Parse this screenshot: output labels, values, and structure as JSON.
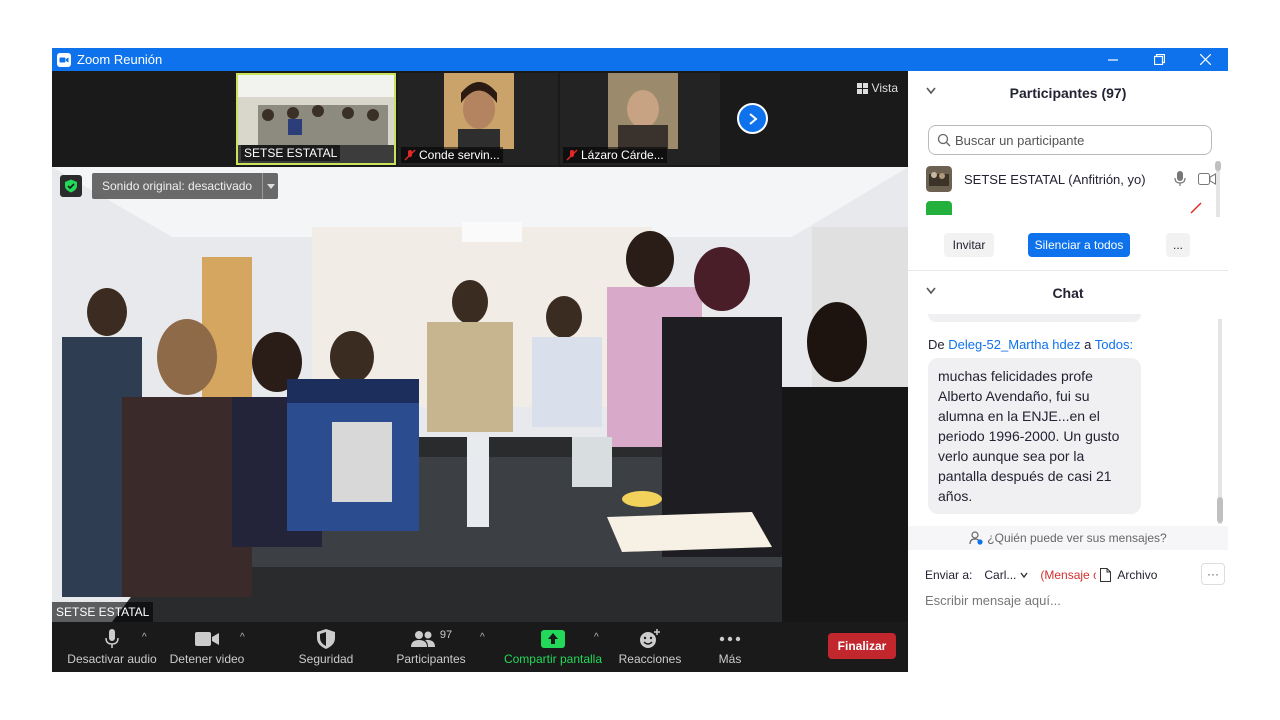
{
  "window": {
    "title": "Zoom Reunión"
  },
  "strip": {
    "thumbnails": [
      {
        "name": "SETSE ESTATAL",
        "muted": false
      },
      {
        "name": "Conde servin...",
        "muted": true
      },
      {
        "name": "Lázaro Cárde...",
        "muted": true
      }
    ],
    "view_label": "Vista"
  },
  "video": {
    "sound_label": "Sonido original: desactivado",
    "speaker_name": "SETSE ESTATAL"
  },
  "toolbar": {
    "mute_label": "Desactivar audio",
    "video_label": "Detener video",
    "security_label": "Seguridad",
    "participants_label": "Participantes",
    "participants_count": "97",
    "share_label": "Compartir pantalla",
    "reactions_label": "Reacciones",
    "more_label": "Más",
    "end_label": "Finalizar"
  },
  "participants_panel": {
    "header": "Participantes (97)",
    "search_placeholder": "Buscar un participante",
    "rows": [
      {
        "name": "SETSE ESTATAL (Anfitrión, yo)"
      }
    ],
    "invite_label": "Invitar",
    "mute_all_label": "Silenciar a todos",
    "more_label": "..."
  },
  "chat_panel": {
    "header": "Chat",
    "message": {
      "prefix": "De",
      "sender": "Deleg-52_Martha hdez",
      "to_word": "a",
      "recipient": "Todos:",
      "text": "muchas felicidades profe Alberto Avendaño, fui su alumna en la ENJE...en el periodo 1996-2000. Un gusto verlo aunque sea por la pantalla después de casi 21 años."
    },
    "who_can_see": "¿Quién puede ver sus mensajes?",
    "send_to_label": "Enviar a:",
    "send_to_value": "Carl...",
    "warning_text": "(Mensaje c",
    "file_label": "Archivo",
    "more_label": "···",
    "input_placeholder": "Escribir mensaje aquí..."
  },
  "colors": {
    "accent": "#0e72ed",
    "end": "#c1272d",
    "share": "#23d959"
  }
}
